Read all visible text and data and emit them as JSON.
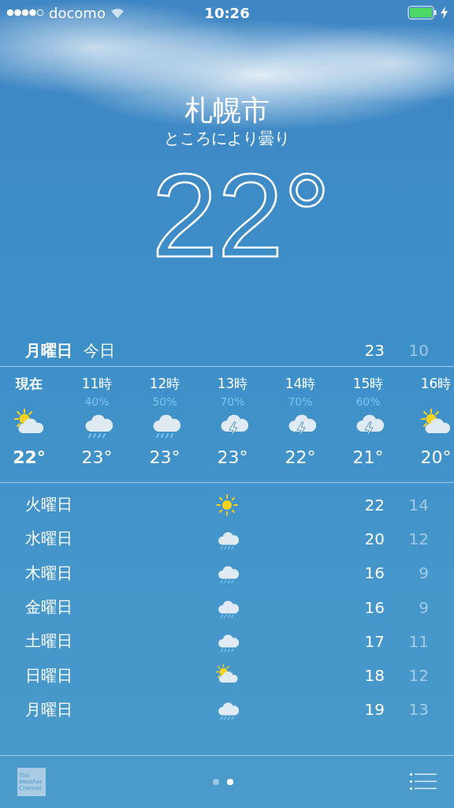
{
  "status_bar": {
    "carrier": "docomo",
    "time": "10:26"
  },
  "location": {
    "city": "札幌市",
    "condition": "ところにより曇り",
    "temperature": "22°"
  },
  "today": {
    "day": "月曜日",
    "label": "今日",
    "high": "23",
    "low": "10"
  },
  "hourly": [
    {
      "time": "現在",
      "now": true,
      "kind": "partly",
      "temp": "22°"
    },
    {
      "time": "11時",
      "now": false,
      "kind": "rain",
      "precip": "40%",
      "temp": "23°"
    },
    {
      "time": "12時",
      "now": false,
      "kind": "rain",
      "precip": "50%",
      "temp": "23°"
    },
    {
      "time": "13時",
      "now": false,
      "kind": "thunder",
      "precip": "70%",
      "temp": "23°"
    },
    {
      "time": "14時",
      "now": false,
      "kind": "thunder",
      "precip": "70%",
      "temp": "22°"
    },
    {
      "time": "15時",
      "now": false,
      "kind": "thunder",
      "precip": "60%",
      "temp": "21°"
    },
    {
      "time": "16時",
      "now": false,
      "kind": "partly",
      "temp": "20°"
    }
  ],
  "daily": [
    {
      "day": "火曜日",
      "kind": "sun",
      "high": "22",
      "low": "14"
    },
    {
      "day": "水曜日",
      "kind": "rain",
      "high": "20",
      "low": "12"
    },
    {
      "day": "木曜日",
      "kind": "rain",
      "high": "16",
      "low": "9"
    },
    {
      "day": "金曜日",
      "kind": "rain",
      "high": "16",
      "low": "9"
    },
    {
      "day": "土曜日",
      "kind": "rain",
      "high": "17",
      "low": "11"
    },
    {
      "day": "日曜日",
      "kind": "partly",
      "high": "18",
      "low": "12"
    },
    {
      "day": "月曜日",
      "kind": "rain",
      "high": "19",
      "low": "13"
    }
  ],
  "footer": {
    "logo": [
      "The",
      "Weather",
      "Channel"
    ],
    "pages": [
      {
        "selected": false
      },
      {
        "selected": true
      }
    ]
  }
}
